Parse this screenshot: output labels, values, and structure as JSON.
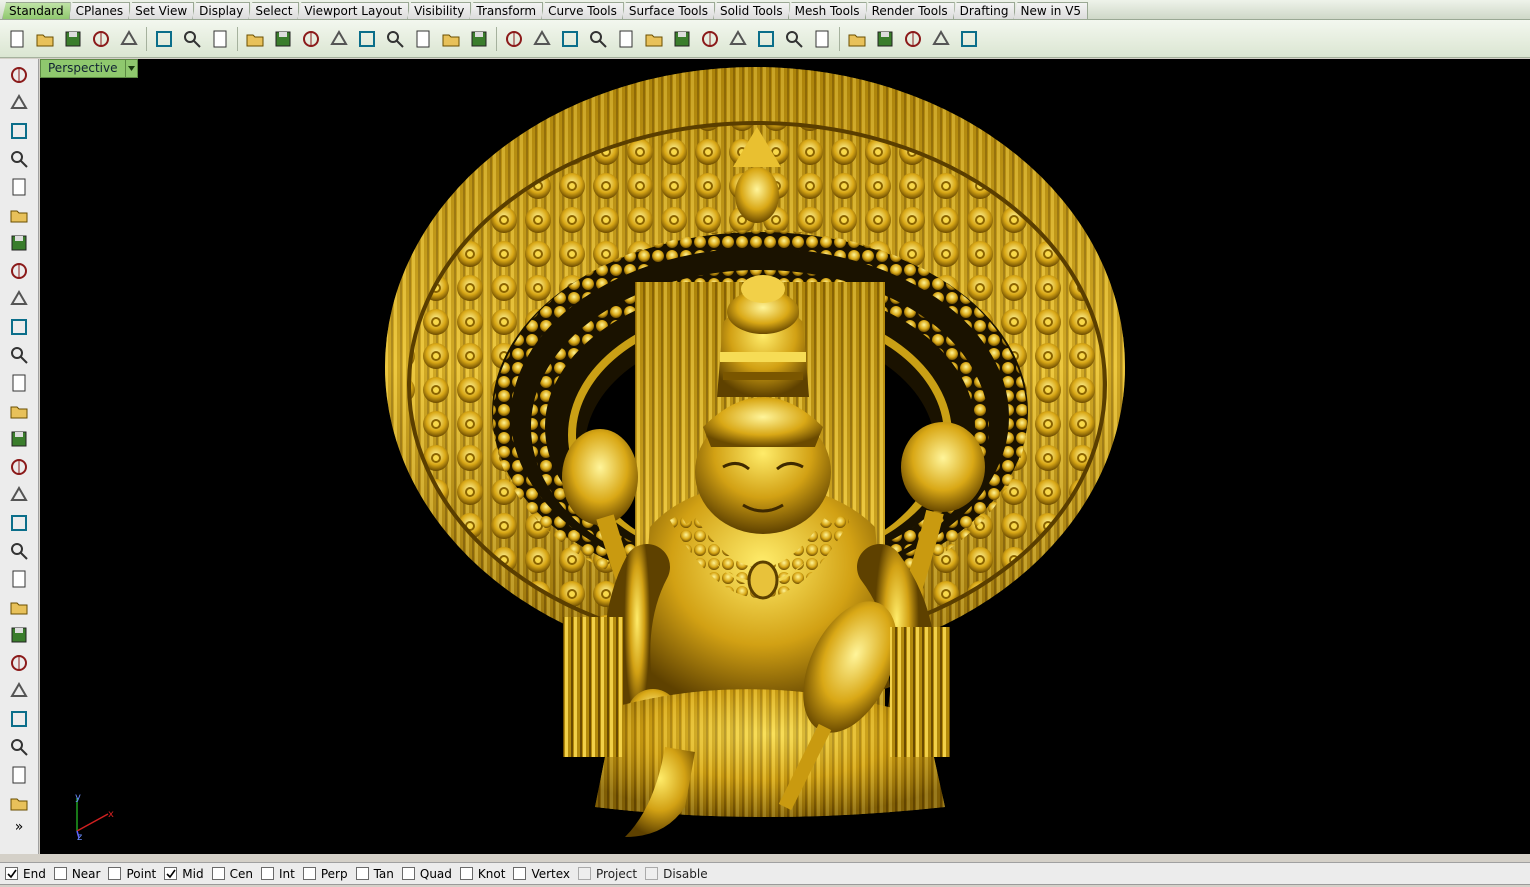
{
  "tabs": [
    "Standard",
    "CPlanes",
    "Set View",
    "Display",
    "Select",
    "Viewport Layout",
    "Visibility",
    "Transform",
    "Curve Tools",
    "Surface Tools",
    "Solid Tools",
    "Mesh Tools",
    "Render Tools",
    "Drafting",
    "New in V5"
  ],
  "active_tab": "Standard",
  "toolbar_icons": [
    "new-file-icon",
    "open-folder-icon",
    "save-icon",
    "print-icon",
    "import-icon",
    "cut-icon",
    "copy-icon",
    "paste-icon",
    "undo-icon",
    "pan-hand-icon",
    "rotate-view-icon",
    "zoom-dynamic-icon",
    "zoom-window-icon",
    "zoom-extents-icon",
    "zoom-selected-icon",
    "undo-view-icon",
    "four-viewports-icon",
    "car-icon",
    "hide-objects-icon",
    "show-objects-icon",
    "layer-icon",
    "lightbulb-icon",
    "lock-icon",
    "properties-icon",
    "color-wheel-icon",
    "render-sphere-icon",
    "shaded-sphere-icon",
    "rendered-sphere-icon",
    "material-sphere-icon",
    "select-filter-icon",
    "options-gear-icon",
    "snap-grid-icon",
    "help-icon",
    "hint-icon"
  ],
  "left_tool_icons": [
    "select-arrow-icon",
    "point-icon",
    "polyline-icon",
    "curve-icon",
    "circle-icon",
    "ellipse-icon",
    "arc-icon",
    "rectangle-icon",
    "polygon-icon",
    "fillet-curve-icon",
    "surface-edit-icon",
    "surface-patch-icon",
    "box-solid-icon",
    "boolean-icon",
    "cylinder-icon",
    "mesh-surface-icon",
    "gear-settings-icon",
    "transform-icon",
    "dimension-icon",
    "dimension-arrow-icon",
    "boolean-union-icon",
    "group-icon",
    "curve-from-surface-icon",
    "extract-icon",
    "text-icon",
    "control-points-icon",
    "array-icon"
  ],
  "left_more": "»",
  "viewport": {
    "title": "Perspective",
    "axis_labels": {
      "x": "x",
      "y": "y",
      "z": "z"
    }
  },
  "colors": {
    "gold_light": "#ffe45a",
    "gold_mid": "#d6a512",
    "gold_dark": "#6b4a00",
    "viewport_bg": "#000000",
    "tab_active": "#8fc86e",
    "axis_x": "#d02020",
    "axis_y": "#20a020",
    "axis_z": "#6060ff"
  },
  "osnaps": [
    {
      "label": "End",
      "checked": true,
      "enabled": true
    },
    {
      "label": "Near",
      "checked": false,
      "enabled": true
    },
    {
      "label": "Point",
      "checked": false,
      "enabled": true
    },
    {
      "label": "Mid",
      "checked": true,
      "enabled": true
    },
    {
      "label": "Cen",
      "checked": false,
      "enabled": true
    },
    {
      "label": "Int",
      "checked": false,
      "enabled": true
    },
    {
      "label": "Perp",
      "checked": false,
      "enabled": true
    },
    {
      "label": "Tan",
      "checked": false,
      "enabled": true
    },
    {
      "label": "Quad",
      "checked": false,
      "enabled": true
    },
    {
      "label": "Knot",
      "checked": false,
      "enabled": true
    },
    {
      "label": "Vertex",
      "checked": false,
      "enabled": true
    },
    {
      "label": "Project",
      "checked": false,
      "enabled": false
    },
    {
      "label": "Disable",
      "checked": false,
      "enabled": false
    }
  ]
}
